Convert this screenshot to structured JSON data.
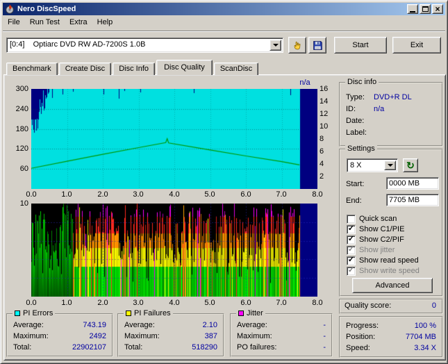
{
  "window": {
    "title": "Nero DiscSpeed"
  },
  "icons": {
    "check": "✓",
    "refresh": "↻",
    "close": "×"
  },
  "colors": {
    "value_text": "#0000A0",
    "titlebar_left": "#0A246A",
    "titlebar_right": "#A6CAF0",
    "window_bg": "#D4D0C8"
  },
  "menu": {
    "items": [
      "File",
      "Run Test",
      "Extra",
      "Help"
    ]
  },
  "toolbar": {
    "drive_selector": "[0:4]    Optiarc DVD RW AD-7200S 1.0B",
    "start_button": "Start",
    "exit_button": "Exit"
  },
  "tabs": {
    "items": [
      "Benchmark",
      "Create Disc",
      "Disc Info",
      "Disc Quality",
      "ScanDisc"
    ],
    "active_index": 3
  },
  "disc_info": {
    "title": "Disc info",
    "rows": [
      {
        "label": "Type:",
        "value": "DVD+R DL"
      },
      {
        "label": "ID:",
        "value": "n/a"
      },
      {
        "label": "Date:",
        "value": ""
      },
      {
        "label": "Label:",
        "value": ""
      }
    ]
  },
  "settings": {
    "title": "Settings",
    "speed_select": "8 X",
    "start_label": "Start:",
    "start_value": "0000 MB",
    "end_label": "End:",
    "end_value": "7705 MB",
    "checkboxes": [
      {
        "label": "Quick scan",
        "checked": false,
        "disabled": false
      },
      {
        "label": "Show C1/PIE",
        "checked": true,
        "disabled": false
      },
      {
        "label": "Show C2/PIF",
        "checked": true,
        "disabled": false
      },
      {
        "label": "Show jitter",
        "checked": true,
        "disabled": true
      },
      {
        "label": "Show read speed",
        "checked": true,
        "disabled": false
      },
      {
        "label": "Show write speed",
        "checked": true,
        "disabled": true
      }
    ],
    "advanced_button": "Advanced"
  },
  "quality": {
    "label": "Quality score:",
    "value": "0"
  },
  "progress": {
    "rows": [
      {
        "label": "Progress:",
        "value": "100 %"
      },
      {
        "label": "Position:",
        "value": "7704 MB"
      },
      {
        "label": "Speed:",
        "value": "3.34 X"
      }
    ]
  },
  "stats": {
    "boxes": [
      {
        "title": "PI Errors",
        "swatch": "#00FFFF",
        "rows": [
          {
            "label": "Average:",
            "value": "743.19"
          },
          {
            "label": "Maximum:",
            "value": "2492"
          },
          {
            "label": "Total:",
            "value": "22902107"
          }
        ]
      },
      {
        "title": "PI Failures",
        "swatch": "#FFFF00",
        "rows": [
          {
            "label": "Average:",
            "value": "2.10"
          },
          {
            "label": "Maximum:",
            "value": "387"
          },
          {
            "label": "Total:",
            "value": "518290"
          }
        ]
      },
      {
        "title": "Jitter",
        "swatch": "#FF00FF",
        "rows": [
          {
            "label": "Average:",
            "value": "-"
          },
          {
            "label": "Maximum:",
            "value": "-"
          },
          {
            "label": "PO failures:",
            "value": "-"
          }
        ]
      }
    ]
  },
  "charts": {
    "top": {
      "na_label": "n/a",
      "left_ticks": [
        "300",
        "240",
        "180",
        "120",
        "60"
      ],
      "right_ticks": [
        "16",
        "14",
        "12",
        "10",
        "8",
        "6",
        "4",
        "2"
      ],
      "x_ticks": [
        "0.0",
        "1.0",
        "2.0",
        "3.0",
        "4.0",
        "5.0",
        "6.0",
        "7.0",
        "8.0"
      ],
      "bg_color": "#000080",
      "fill_color": "#00E0E0",
      "line_color": "#009800",
      "y_max": 300,
      "x_max": 8,
      "data_end": 7.53,
      "speed_points": [
        [
          0,
          62
        ],
        [
          1.0,
          83
        ],
        [
          2.0,
          104
        ],
        [
          3.0,
          124
        ],
        [
          3.76,
          139
        ],
        [
          3.8,
          151
        ],
        [
          3.84,
          138
        ],
        [
          5.0,
          117
        ],
        [
          6.0,
          99
        ],
        [
          7.0,
          82
        ],
        [
          7.5,
          72
        ]
      ]
    },
    "bottom": {
      "top_tick": "10",
      "x_ticks": [
        "0.0",
        "1.0",
        "2.0",
        "3.0",
        "4.0",
        "5.0",
        "6.0",
        "7.0",
        "8.0"
      ],
      "bg_color": "#000000",
      "na_color": "#000080",
      "y_max": 10,
      "x_max": 8,
      "data_end": 7.53
    }
  }
}
